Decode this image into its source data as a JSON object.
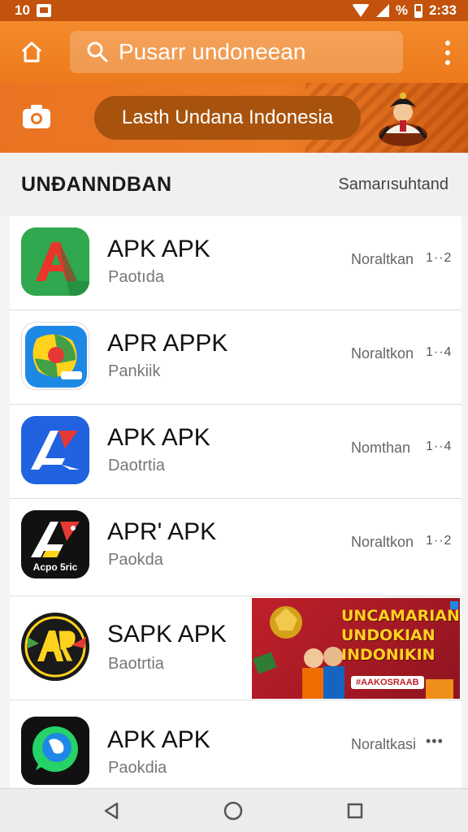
{
  "status_bar": {
    "left_text": "10",
    "battery_percent_symbol": "%",
    "time": "2:33"
  },
  "toolbar": {
    "search_text": "Pusarr undoneean"
  },
  "banner": {
    "pill_text": "Lasth Undana Indonesia"
  },
  "section": {
    "title": "UNĐANNDBAN",
    "link": "Samarısuhtand"
  },
  "apps": [
    {
      "name": "APK APK",
      "sub": "Paotıda",
      "status": "Noraltkan",
      "count": "1··2",
      "icon": "green-a-icon"
    },
    {
      "name": "APR APPK",
      "sub": "Pankiik",
      "status": "Noraltkon",
      "count": "1··4",
      "icon": "map-pin-icon"
    },
    {
      "name": "APK APK",
      "sub": "Daotrtia",
      "status": "Nomthan",
      "count": "1··4",
      "icon": "blue-a-icon"
    },
    {
      "name": "APR' APK",
      "sub": "Paokda",
      "status": "Noraltkon",
      "count": "1··2",
      "icon": "black-a-icon",
      "icon_caption": "Acpo 5ric"
    },
    {
      "name": "SAPK APK",
      "sub": "Baotrtia",
      "icon": "ar-badge-icon",
      "promo": {
        "line1": "UNCAMARIAN",
        "line2": "UNDOKIAN",
        "line3": "INDONIKIN",
        "tag": "#AAKOSRAAB"
      }
    },
    {
      "name": "APK APK",
      "sub": "Paokdia",
      "status": "Noraltkasi",
      "count": "•••",
      "icon": "whatsapp-icon"
    }
  ],
  "colors": {
    "status_bar": "#c2520c",
    "toolbar": "#f0802a",
    "banner": "#ea7624",
    "pill": "#a8530d"
  }
}
